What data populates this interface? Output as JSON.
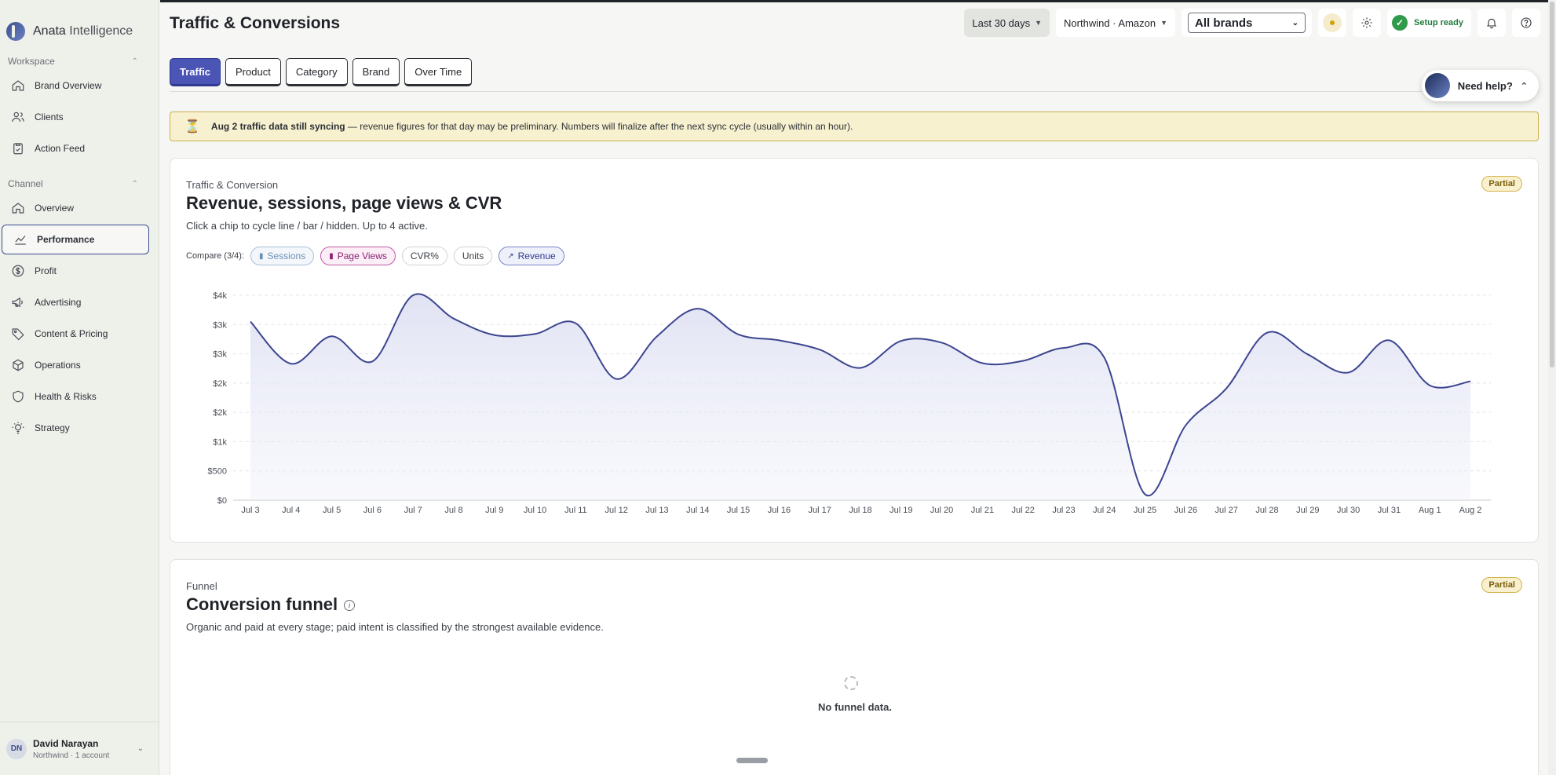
{
  "app": {
    "name_bold": "Anata",
    "name_rest": " Intelligence"
  },
  "sidebar": {
    "workspace_label": "Workspace",
    "channel_label": "Channel",
    "workspace_items": [
      {
        "label": "Brand Overview",
        "icon": "home-icon"
      },
      {
        "label": "Clients",
        "icon": "users-icon"
      },
      {
        "label": "Action Feed",
        "icon": "clipboard-icon"
      }
    ],
    "channel_items": [
      {
        "label": "Overview",
        "icon": "home-icon"
      },
      {
        "label": "Performance",
        "icon": "chart-line-icon",
        "active": true
      },
      {
        "label": "Profit",
        "icon": "dollar-icon"
      },
      {
        "label": "Advertising",
        "icon": "megaphone-icon"
      },
      {
        "label": "Content & Pricing",
        "icon": "tag-icon"
      },
      {
        "label": "Operations",
        "icon": "box-icon"
      },
      {
        "label": "Health & Risks",
        "icon": "shield-icon"
      },
      {
        "label": "Strategy",
        "icon": "bulb-icon"
      }
    ],
    "user": {
      "initials": "DN",
      "name": "David Narayan",
      "sub": "Northwind · 1 account"
    }
  },
  "header": {
    "title": "Traffic & Conversions",
    "date_range": "Last 30 days",
    "account": "Northwind · Amazon",
    "brand_select": "All brands",
    "setup_status": "Setup ready"
  },
  "tabs": [
    "Traffic",
    "Product",
    "Category",
    "Brand",
    "Over Time"
  ],
  "help": {
    "label": "Need help?"
  },
  "banner": {
    "bold": "Aug 2 traffic data still syncing",
    "rest": " — revenue figures for that day may be preliminary. Numbers will finalize after the next sync cycle (usually within an hour)."
  },
  "traffic_card": {
    "eyebrow": "Traffic & Conversion",
    "title": "Revenue, sessions, page views & CVR",
    "desc": "Click a chip to cycle line / bar / hidden. Up to 4 active.",
    "badge": "Partial",
    "compare_label": "Compare (3/4):",
    "chips": {
      "sessions": "Sessions",
      "pageviews": "Page Views",
      "cvr": "CVR%",
      "units": "Units",
      "revenue": "Revenue"
    }
  },
  "funnel_card": {
    "eyebrow": "Funnel",
    "title": "Conversion funnel",
    "desc": "Organic and paid at every stage; paid intent is classified by the strongest available evidence.",
    "badge": "Partial",
    "empty": "No funnel data."
  },
  "colors": {
    "accent": "#4a55b5",
    "line": "#3d4590",
    "fill": "#e8e9f6"
  },
  "chart_data": {
    "type": "area",
    "title": "",
    "xlabel": "",
    "ylabel": "",
    "ylim": [
      0,
      3500
    ],
    "yticks": [
      0,
      500,
      1000,
      1500,
      2000,
      2500,
      3000,
      3500
    ],
    "ytick_labels": [
      "$0",
      "$500",
      "$1k",
      "$2k",
      "$2k",
      "$3k",
      "$3k",
      "$4k"
    ],
    "x": [
      "Jul 3",
      "Jul 4",
      "Jul 5",
      "Jul 6",
      "Jul 7",
      "Jul 8",
      "Jul 9",
      "Jul 10",
      "Jul 11",
      "Jul 12",
      "Jul 13",
      "Jul 14",
      "Jul 15",
      "Jul 16",
      "Jul 17",
      "Jul 18",
      "Jul 19",
      "Jul 20",
      "Jul 21",
      "Jul 22",
      "Jul 23",
      "Jul 24",
      "Jul 25",
      "Jul 26",
      "Jul 27",
      "Jul 28",
      "Jul 29",
      "Jul 30",
      "Jul 31",
      "Aug 1",
      "Aug 2"
    ],
    "series": [
      {
        "name": "Revenue",
        "values": [
          3050,
          2330,
          2800,
          2370,
          3500,
          3100,
          2820,
          2840,
          3020,
          2070,
          2800,
          3270,
          2830,
          2730,
          2570,
          2260,
          2720,
          2690,
          2340,
          2380,
          2600,
          2430,
          100,
          1280,
          1910,
          2860,
          2490,
          2180,
          2730,
          1960,
          2030
        ]
      }
    ],
    "grid": true,
    "legend": "none"
  }
}
